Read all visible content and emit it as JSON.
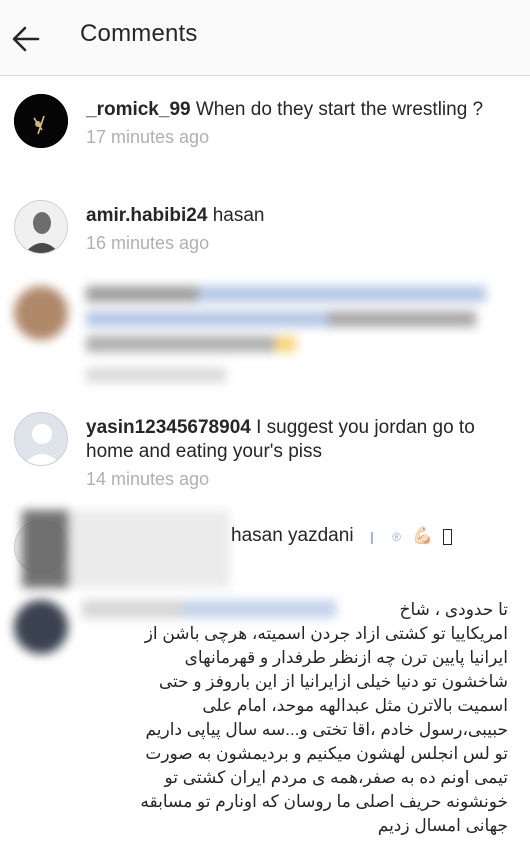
{
  "header": {
    "title": "Comments"
  },
  "comments": [
    {
      "username": "_romick_99",
      "text": "When do they start the wrestling ?",
      "time": "17 minutes ago"
    },
    {
      "username": "amir.habibi24",
      "text": "hasan",
      "time": "16 minutes ago"
    },
    {
      "username": "yasin12345678904",
      "text": "I suggest you jordan go to home and eating your's piss",
      "time": "14 minutes ago"
    },
    {
      "visible_text": "hasan yazdani",
      "emoji": "💪🏻"
    },
    {
      "text_lines": [
        "تا حدودی ، شاخ",
        "امریکاییا تو کشتی ازاد جردن اسمیته، هرچی باشن از",
        "ایرانیا پایین ترن چه ازنظر طرفدار و قهرمانهای",
        "شاخشون تو دنیا خیلی ازایرانیا از این باروفز و حتی",
        "اسمیت بالاترن مثل عبدالهه موحد، امام علی",
        "حبیبی،رسول خادم ،اقا تختی و...سه سال پیاپی داریم",
        "تو لس انجلس لهشون میکنیم و بردیمشون به صورت",
        "تیمی اونم ده به صفر،همه ی مردم ایران کشتی تو",
        "خونشونه حریف اصلی ما روسان که اونارم تو مسابقه",
        "جهانی امسال زدیم"
      ]
    }
  ],
  "colors": {
    "header_bg": "#fafafa",
    "text": "#262626",
    "timestamp": "#b0b0b0",
    "divider": "#dbdbdb"
  },
  "icons": {
    "back": "back-arrow-icon"
  }
}
